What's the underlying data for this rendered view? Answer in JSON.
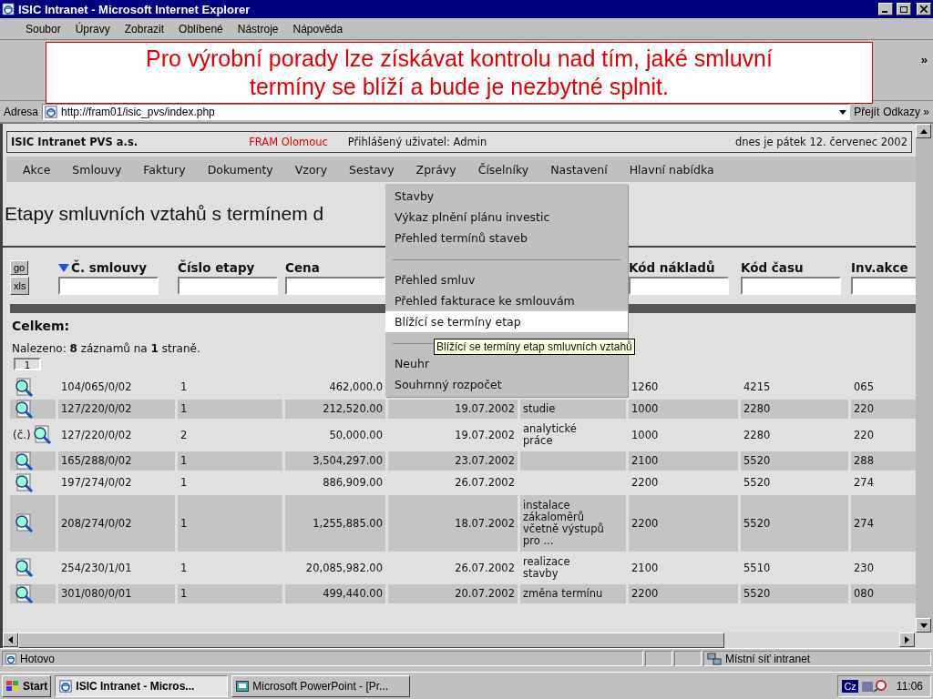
{
  "window": {
    "title": "ISIC Intranet - Microsoft Internet Explorer"
  },
  "menu_bar": [
    "Soubor",
    "Úpravy",
    "Zobrazit",
    "Oblíbené",
    "Nástroje",
    "Nápověda"
  ],
  "toolbar": {
    "more": "»"
  },
  "address_bar": {
    "label": "Adresa",
    "url": "http://fram01/isic_pvs/index.php",
    "go": "Přejít",
    "links": "Odkazy",
    "more": "»"
  },
  "callout": "Pro výrobní porady lze získávat kontrolu nad tím, jaké smluvní termíny se blíží a bude je nezbytné splnit.",
  "info_bar": {
    "company": "ISIC Intranet PVS a.s.",
    "site": "FRAM Olomouc",
    "user": "Přihlášený uživatel: Admin",
    "date": "dnes je pátek 12. červenec 2002"
  },
  "nav": [
    "Akce",
    "Smlouvy",
    "Faktury",
    "Dokumenty",
    "Vzory",
    "Sestavy",
    "Zprávy",
    "Číselníky",
    "Nastavení",
    "Hlavní nabídka"
  ],
  "dropdown": [
    {
      "kind": "item",
      "label": "Stavby",
      "selected": false
    },
    {
      "kind": "item",
      "label": "Výkaz plnění plánu investic",
      "selected": false
    },
    {
      "kind": "item",
      "label": "Přehled termínů staveb",
      "selected": false
    },
    {
      "kind": "separator"
    },
    {
      "kind": "item",
      "label": "Přehled smluv",
      "selected": false
    },
    {
      "kind": "item",
      "label": "Přehled fakturace ke smlouvám",
      "selected": false
    },
    {
      "kind": "item",
      "label": "Blížící se termíny etap",
      "selected": true
    },
    {
      "kind": "separator"
    },
    {
      "kind": "item",
      "label": "Neuhr",
      "selected": false
    },
    {
      "kind": "item",
      "label": "Souhrnný rozpočet",
      "selected": false
    }
  ],
  "tooltip": "Blížící se termíny etap smluvních vztahů",
  "page_title": "Etapy smluvních vztahů s termínem d",
  "table": {
    "buttons": [
      "go",
      "xls"
    ],
    "columns_left": [
      {
        "label": "Č. smlouvy",
        "sorted": true
      },
      {
        "label": "Číslo etapy",
        "sorted": false
      },
      {
        "label": "Cena",
        "sorted": false
      }
    ],
    "columns_right": [
      {
        "label": "Kód nákladů",
        "sorted": false
      },
      {
        "label": "Kód času",
        "sorted": false
      },
      {
        "label": "Inv.akce",
        "sorted": false
      }
    ],
    "total_label": "Celkem:",
    "found": "Nalezeno: **8** záznamů na **1** straně.",
    "page": "1",
    "rows": [
      {
        "contract": "104/065/0/02",
        "stage": "1",
        "price": "462,000.0",
        "cost_code": "1260",
        "time_code": "4215",
        "inv_action": "065"
      },
      {
        "contract": "127/220/0/02",
        "stage": "1",
        "price": "212,520.00",
        "date": "19.07.2002",
        "description": "studie",
        "cost_code": "1000",
        "time_code": "2280",
        "inv_action": "220"
      },
      {
        "note": "(č.)",
        "contract": "127/220/0/02",
        "stage": "2",
        "price": "50,000.00",
        "date": "19.07.2002",
        "description": "analytické práce",
        "cost_code": "1000",
        "time_code": "2280",
        "inv_action": "220"
      },
      {
        "contract": "165/288/0/02",
        "stage": "1",
        "price": "3,504,297.00",
        "date": "23.07.2002",
        "cost_code": "2100",
        "time_code": "5520",
        "inv_action": "288"
      },
      {
        "contract": "197/274/0/02",
        "stage": "1",
        "price": "886,909.00",
        "date": "26.07.2002",
        "cost_code": "2200",
        "time_code": "5520",
        "inv_action": "274"
      },
      {
        "contract": "208/274/0/02",
        "stage": "1",
        "price": "1,255,885.00",
        "date": "18.07.2002",
        "description": "instalace zákaloměrů včetně výstupů pro ...",
        "cost_code": "2200",
        "time_code": "5520",
        "inv_action": "274"
      },
      {
        "contract": "254/230/1/01",
        "stage": "1",
        "price": "20,085,982.00",
        "date": "26.07.2002",
        "description": "realizace stavby",
        "cost_code": "2100",
        "time_code": "5510",
        "inv_action": "230"
      },
      {
        "contract": "301/080/0/01",
        "stage": "1",
        "price": "499,440.00",
        "date": "20.07.2002",
        "description": "změna termínu",
        "cost_code": "2200",
        "time_code": "5520",
        "inv_action": "080"
      }
    ]
  },
  "status_bar": {
    "text": "Hotovo",
    "zone": "Místní síť intranet"
  },
  "taskbar": {
    "start": "Start",
    "tasks": [
      {
        "label": "ISIC Intranet - Micros...",
        "selected": true
      },
      {
        "label": "Microsoft PowerPoint - [Pr...",
        "selected": false
      }
    ],
    "language": "Cz",
    "clock": "11:06"
  }
}
